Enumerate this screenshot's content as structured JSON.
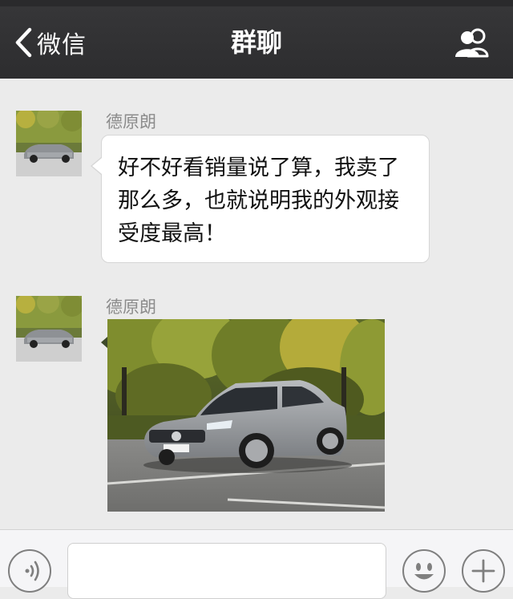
{
  "navbar": {
    "back_label": "微信",
    "title": "群聊"
  },
  "messages": [
    {
      "sender": "德原朗",
      "type": "text",
      "text": "好不好看销量说了算，我卖了那么多，也就说明我的外观接受度最高！"
    },
    {
      "sender": "德原朗",
      "type": "image"
    }
  ],
  "icons": {
    "back": "chevron-left-icon",
    "group": "group-people-icon",
    "voice": "voice-icon",
    "emoji": "smiley-icon",
    "plus": "plus-icon"
  },
  "input": {
    "value": ""
  },
  "colors": {
    "navbar_bg": "#2d2d2f",
    "chat_bg": "#ebebeb",
    "bubble_bg": "#ffffff",
    "sender_name": "#8c8c8c"
  }
}
